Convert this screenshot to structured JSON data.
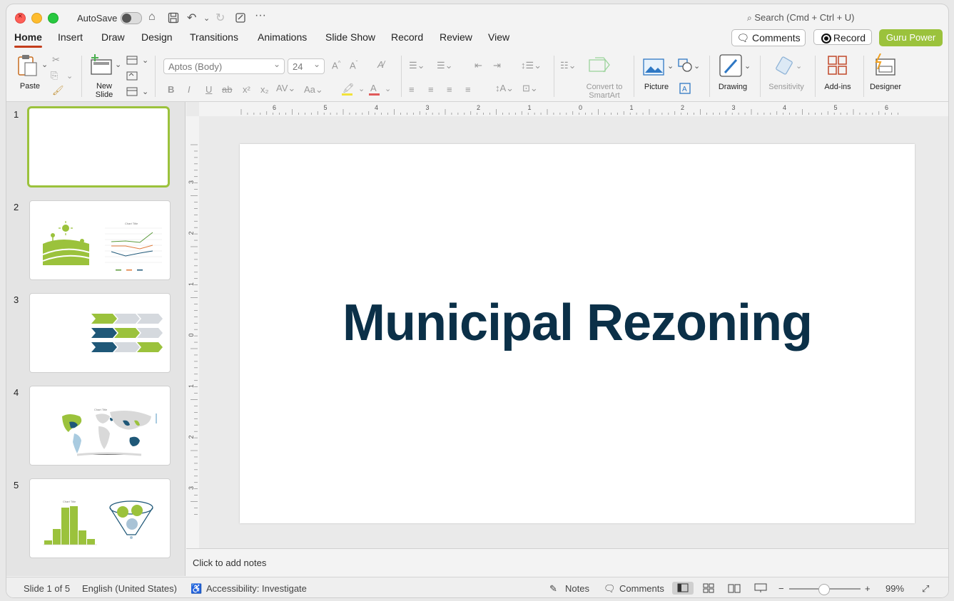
{
  "titlebar": {
    "autosave_label": "AutoSave",
    "search_placeholder": "Search (Cmd + Ctrl + U)"
  },
  "tabs": [
    "Home",
    "Insert",
    "Draw",
    "Design",
    "Transitions",
    "Animations",
    "Slide Show",
    "Record",
    "Review",
    "View"
  ],
  "top_right": {
    "comments_label": "Comments",
    "record_label": "Record",
    "guru_label": "Guru Power"
  },
  "ribbon": {
    "paste": "Paste",
    "new_slide": "New\nSlide",
    "font_name": "Aptos (Body)",
    "font_size": "24",
    "convert_smartart": "Convert to\nSmartArt",
    "picture": "Picture",
    "drawing": "Drawing",
    "sensitivity": "Sensitivity",
    "addins": "Add-ins",
    "designer": "Designer"
  },
  "slides": [
    {
      "number": "1"
    },
    {
      "number": "2"
    },
    {
      "number": "3"
    },
    {
      "number": "4"
    },
    {
      "number": "5"
    }
  ],
  "thumbnail_texts": {
    "chart_title": "Chart Title"
  },
  "ruler_h_labels": [
    "6",
    "5",
    "4",
    "3",
    "2",
    "1",
    "0",
    "1",
    "2",
    "3",
    "4",
    "5",
    "6"
  ],
  "ruler_v_labels": [
    "3",
    "2",
    "1",
    "0",
    "1",
    "2",
    "3"
  ],
  "slide": {
    "title": "Municipal Rezoning"
  },
  "notes_placeholder": "Click to add notes",
  "status": {
    "slide_of": "Slide 1 of 5",
    "language": "English (United States)",
    "accessibility": "Accessibility: Investigate",
    "notes": "Notes",
    "comments": "Comments",
    "zoom": "99%"
  },
  "colors": {
    "accent": "#9bc23c",
    "title": "#0b3048",
    "tab_underline": "#c43e1c",
    "navy": "#1f5878"
  }
}
